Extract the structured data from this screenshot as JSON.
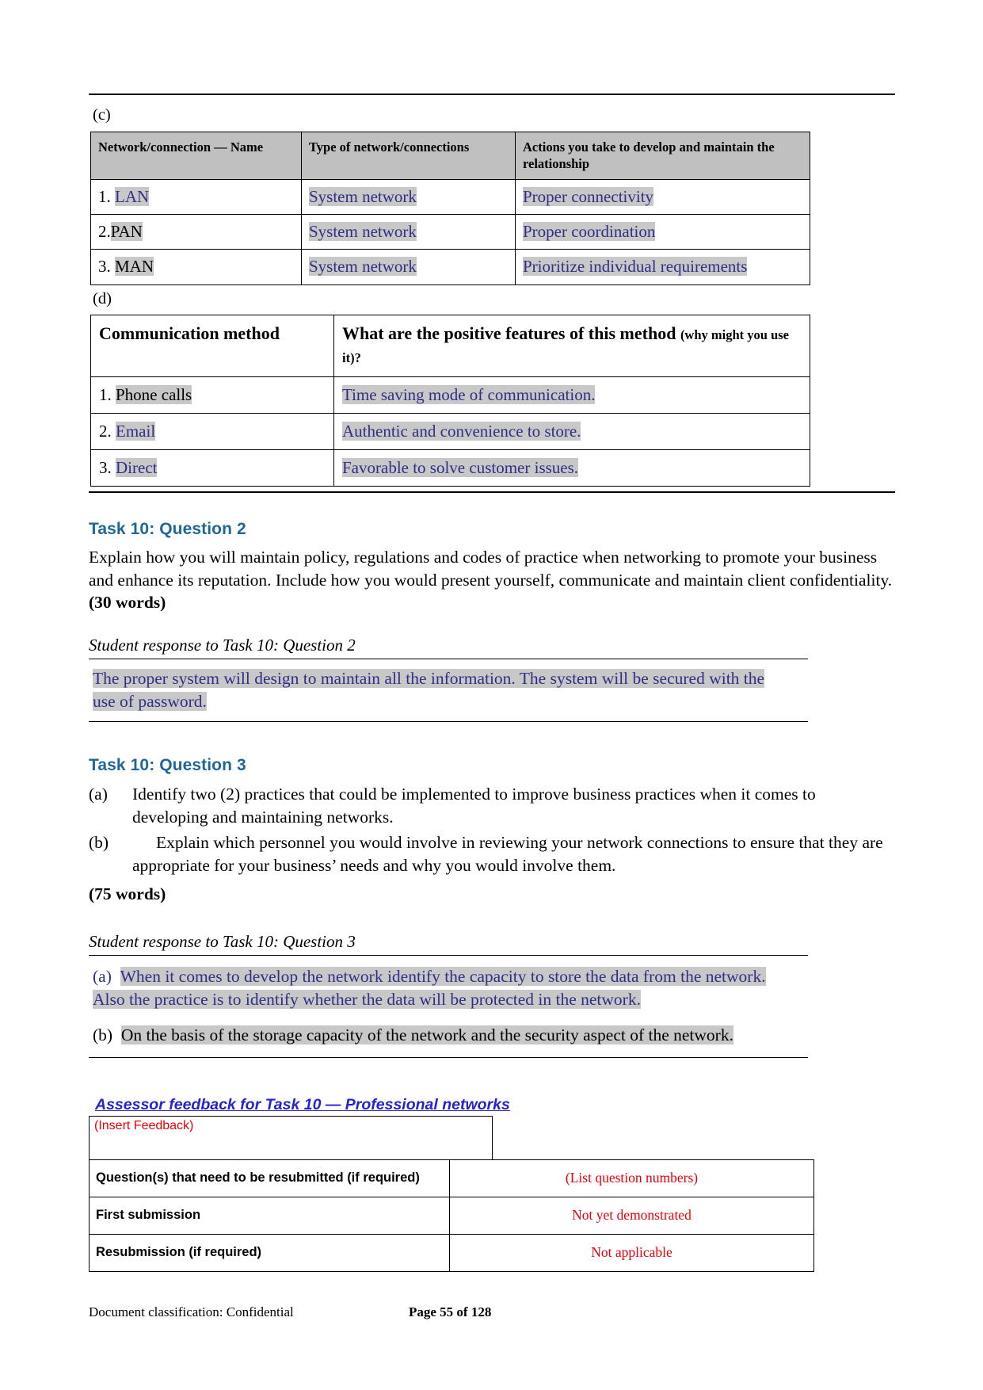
{
  "section_c": {
    "label": "(c)",
    "columns": [
      "Network/connection — Name",
      "Type of network/connections",
      "Actions you take to develop and maintain the relationship"
    ],
    "rows": [
      {
        "num": "1. ",
        "name": "LAN",
        "type": "System network",
        "action": "Proper connectivity"
      },
      {
        "num": "2.",
        "name": "PAN",
        "type": "System network",
        "action": "Proper coordination"
      },
      {
        "num": "3. ",
        "name": "MAN",
        "type": "System network",
        "action": "Prioritize individual requirements"
      }
    ]
  },
  "section_d": {
    "label": "(d)",
    "col1_header": "Communication method",
    "col2_header_main": "What are the positive features of this method ",
    "col2_header_small": "(why might you use it)?",
    "rows": [
      {
        "num": "1. ",
        "method": "Phone calls",
        "feature": "Time saving mode of communication."
      },
      {
        "num": "2. ",
        "method": "Email",
        "feature": "Authentic and convenience to store."
      },
      {
        "num": "3. ",
        "method": "Direct",
        "feature": "Favorable to solve customer issues."
      }
    ]
  },
  "task_q2": {
    "heading": "Task 10: Question 2",
    "prompt": "Explain how you will maintain policy, regulations and codes of practice when networking to promote your business and enhance its reputation. Include how you would present yourself, communicate and maintain client confidentiality. ",
    "word_limit": "(30 words)",
    "response_heading": "Student response to Task 10: Question 2",
    "response_line1": "The proper system will design to maintain all the information. The system will be secured with the",
    "response_line2": "use of password."
  },
  "task_q3": {
    "heading": "Task 10: Question 3",
    "items": [
      {
        "marker": "(a)",
        "text": "Identify two (2) practices that could be implemented to improve business practices when it comes to developing and maintaining networks."
      },
      {
        "marker": "(b)",
        "text": "Explain which personnel you would involve in reviewing your network connections to ensure that they are appropriate for your business’ needs and why you would involve them."
      }
    ],
    "word_limit": "(75 words)",
    "response_heading": "Student response to Task 10: Question 3",
    "response_a_marker": "(a)",
    "response_a_line1": "When it comes to develop the network identify the capacity to store the data from the network.",
    "response_a_line2": "Also the practice is to identify whether the data will be protected in the network.",
    "response_b_marker": "(b)",
    "response_b_text": "On the basis of the storage capacity of the network and the security aspect of the network."
  },
  "assessor": {
    "title": "Assessor feedback for Task 10 — Professional networks",
    "feedback_placeholder": "(Insert Feedback)",
    "rows": [
      {
        "label": "Question(s) that need to be resubmitted (if required)",
        "value": "(List question numbers)"
      },
      {
        "label": "First submission",
        "value": "Not yet demonstrated"
      },
      {
        "label": "Resubmission (if required)",
        "value": "Not applicable"
      }
    ]
  },
  "footer": {
    "classification": "Document classification: Confidential",
    "page": "Page 55 of 128"
  },
  "colors": {
    "heading_blue": "#1f6699",
    "response_blue": "#2f2f84",
    "assessor_blue": "#2323d0",
    "feedback_red": "#e8000b",
    "highlight_gray": "#c8c8c8",
    "table_header_gray": "#c0c0c0"
  }
}
